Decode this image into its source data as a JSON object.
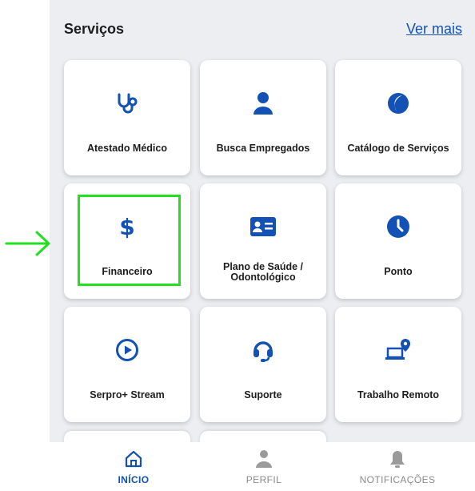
{
  "services": {
    "title": "Serviços",
    "see_more": "Ver mais",
    "cards": [
      {
        "label": "Atestado Médico",
        "icon": "stethoscope-icon"
      },
      {
        "label": "Busca Empregados",
        "icon": "user-icon"
      },
      {
        "label": "Catálogo de Serviços",
        "icon": "catalog-logo-icon"
      },
      {
        "label": "Financeiro",
        "icon": "dollar-icon"
      },
      {
        "label_line1": "Plano de Saúde /",
        "label_line2": "Odontológico",
        "icon": "id-card-icon"
      },
      {
        "label": "Ponto",
        "icon": "clock-icon"
      },
      {
        "label": "Serpro+ Stream",
        "icon": "play-circle-icon"
      },
      {
        "label": "Suporte",
        "icon": "headset-icon"
      },
      {
        "label": "Trabalho Remoto",
        "icon": "laptop-location-icon"
      }
    ]
  },
  "bottom_nav": {
    "items": [
      {
        "label": "INÍCIO",
        "icon": "home-icon",
        "active": true
      },
      {
        "label": "PERFIL",
        "icon": "person-icon",
        "active": false
      },
      {
        "label": "NOTIFICAÇÕES",
        "icon": "bell-icon",
        "active": false
      }
    ]
  },
  "colors": {
    "accent": "#1351b4",
    "panel_bg": "#eceef2",
    "highlight": "#22e01f",
    "inactive": "#8a8a8a"
  }
}
